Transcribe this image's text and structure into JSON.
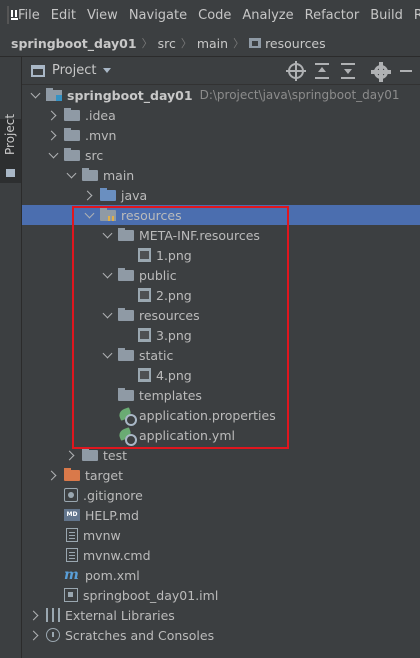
{
  "menubar": {
    "items": [
      "File",
      "Edit",
      "View",
      "Navigate",
      "Code",
      "Analyze",
      "Refactor",
      "Build",
      "R"
    ]
  },
  "breadcrumb": {
    "items": [
      "springboot_day01",
      "src",
      "main",
      "resources"
    ]
  },
  "side_stripe": {
    "tab_label": "Project"
  },
  "panel": {
    "title": "Project"
  },
  "tree": [
    {
      "label": "springboot_day01",
      "path": "D:\\project\\java\\springboot_day01",
      "icon": "project-folder-icon",
      "expanded": true
    },
    {
      "label": ".idea",
      "icon": "folder-icon"
    },
    {
      "label": ".mvn",
      "icon": "folder-icon"
    },
    {
      "label": "src",
      "icon": "folder-icon"
    },
    {
      "label": "main",
      "icon": "folder-icon"
    },
    {
      "label": "java",
      "icon": "source-folder-icon"
    },
    {
      "label": "resources",
      "icon": "resources-folder-icon",
      "selected": true
    },
    {
      "label": "META-INF.resources",
      "icon": "folder-icon"
    },
    {
      "label": "1.png",
      "icon": "image-file-icon"
    },
    {
      "label": "public",
      "icon": "folder-icon"
    },
    {
      "label": "2.png",
      "icon": "image-file-icon"
    },
    {
      "label": "resources",
      "icon": "folder-icon"
    },
    {
      "label": "3.png",
      "icon": "image-file-icon"
    },
    {
      "label": "static",
      "icon": "folder-icon"
    },
    {
      "label": "4.png",
      "icon": "image-file-icon"
    },
    {
      "label": "templates",
      "icon": "folder-icon"
    },
    {
      "label": "application.properties",
      "icon": "spring-config-icon"
    },
    {
      "label": "application.yml",
      "icon": "spring-config-icon"
    },
    {
      "label": "test",
      "icon": "folder-icon"
    },
    {
      "label": "target",
      "icon": "excluded-folder-icon"
    },
    {
      "label": ".gitignore",
      "icon": "gitignore-file-icon"
    },
    {
      "label": "HELP.md",
      "icon": "markdown-file-icon"
    },
    {
      "label": "mvnw",
      "icon": "text-file-icon"
    },
    {
      "label": "mvnw.cmd",
      "icon": "text-file-icon"
    },
    {
      "label": "pom.xml",
      "icon": "maven-file-icon"
    },
    {
      "label": "springboot_day01.iml",
      "icon": "module-file-icon"
    },
    {
      "label": "External Libraries",
      "icon": "libraries-icon"
    },
    {
      "label": "Scratches and Consoles",
      "icon": "scratches-icon"
    }
  ],
  "colors": {
    "selection": "#4b6eaf",
    "highlight_box": "#e0161e",
    "background": "#3c3f41"
  }
}
